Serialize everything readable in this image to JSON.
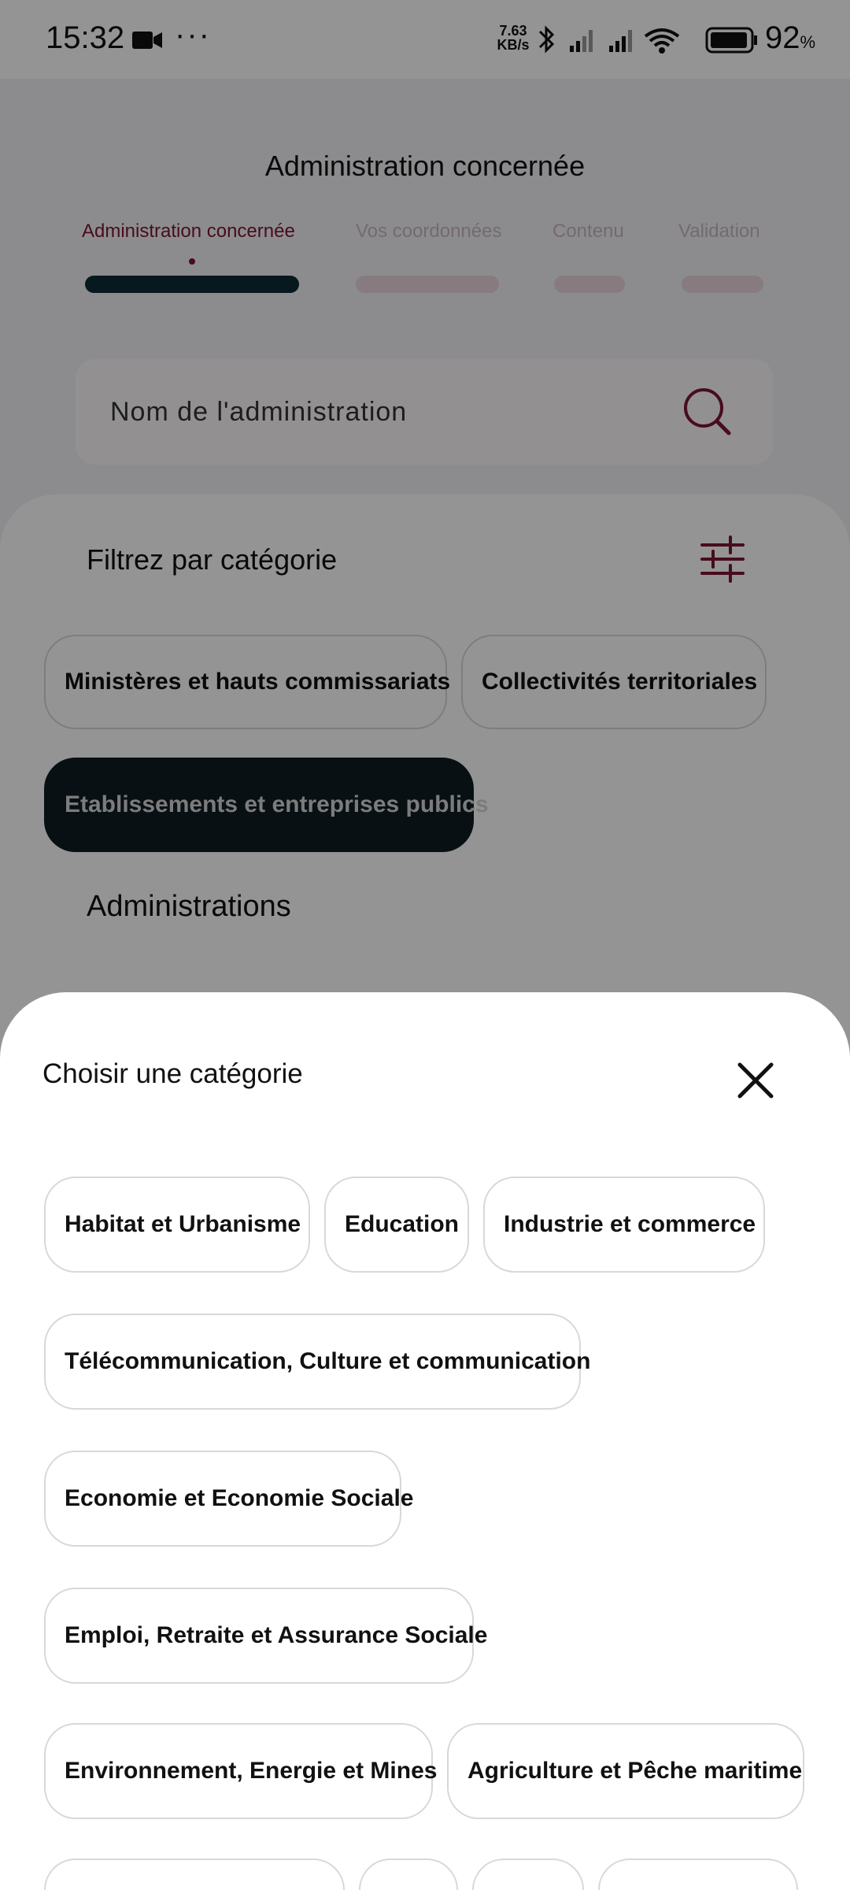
{
  "status_bar": {
    "time": "15:32",
    "dots": "···",
    "speed_value": "7.63",
    "speed_unit": "KB/s",
    "battery": "92",
    "battery_unit": "%"
  },
  "page": {
    "title": "Administration concernée",
    "steps": [
      {
        "label": "Administration concernée",
        "state": "active"
      },
      {
        "label": "Vos coordonnées",
        "state": "inactive"
      },
      {
        "label": "Contenu",
        "state": "inactive"
      },
      {
        "label": "Validation",
        "state": "inactive"
      }
    ],
    "search": {
      "placeholder": "Nom de l'administration"
    },
    "filter": {
      "title": "Filtrez par catégorie",
      "chips": [
        {
          "label": "Ministères et hauts commissariats",
          "selected": false
        },
        {
          "label": "Collectivités territoriales",
          "selected": false
        },
        {
          "label": "Etablissements et entreprises publics",
          "selected": true
        }
      ]
    },
    "administrations_title": "Administrations"
  },
  "sheet": {
    "title": "Choisir une catégorie",
    "categories": [
      {
        "label": "Habitat et Urbanisme"
      },
      {
        "label": "Education"
      },
      {
        "label": "Industrie et commerce"
      },
      {
        "label": "Télécommunication, Culture et communication"
      },
      {
        "label": "Economie et Economie Sociale"
      },
      {
        "label": "Emploi, Retraite et Assurance Sociale"
      },
      {
        "label": "Environnement, Energie et Mines"
      },
      {
        "label": "Agriculture et Pêche maritime"
      }
    ]
  },
  "colors": {
    "accent": "#7a1633",
    "dark": "#0e1c24",
    "inactive_step": "#e9d4db"
  }
}
